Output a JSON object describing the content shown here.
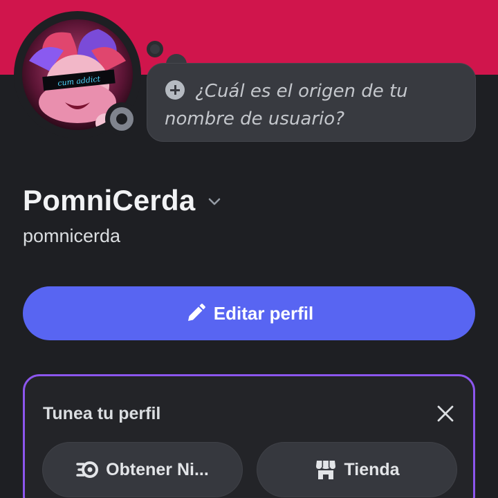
{
  "profile": {
    "avatar_text": "cum addict",
    "status": "offline",
    "custom_status_prompt": "¿Cuál es el origen de tu nombre de usuario?",
    "display_name": "PomniCerda",
    "username": "pomnicerda"
  },
  "actions": {
    "edit_profile_label": "Editar perfil"
  },
  "customize_card": {
    "title": "Tunea tu perfil",
    "nitro_label": "Obtener Ni...",
    "shop_label": "Tienda"
  },
  "colors": {
    "banner": "#d0154c",
    "background": "#1e1f23",
    "brand": "#5865f2",
    "card_border": "#8c56ee"
  }
}
